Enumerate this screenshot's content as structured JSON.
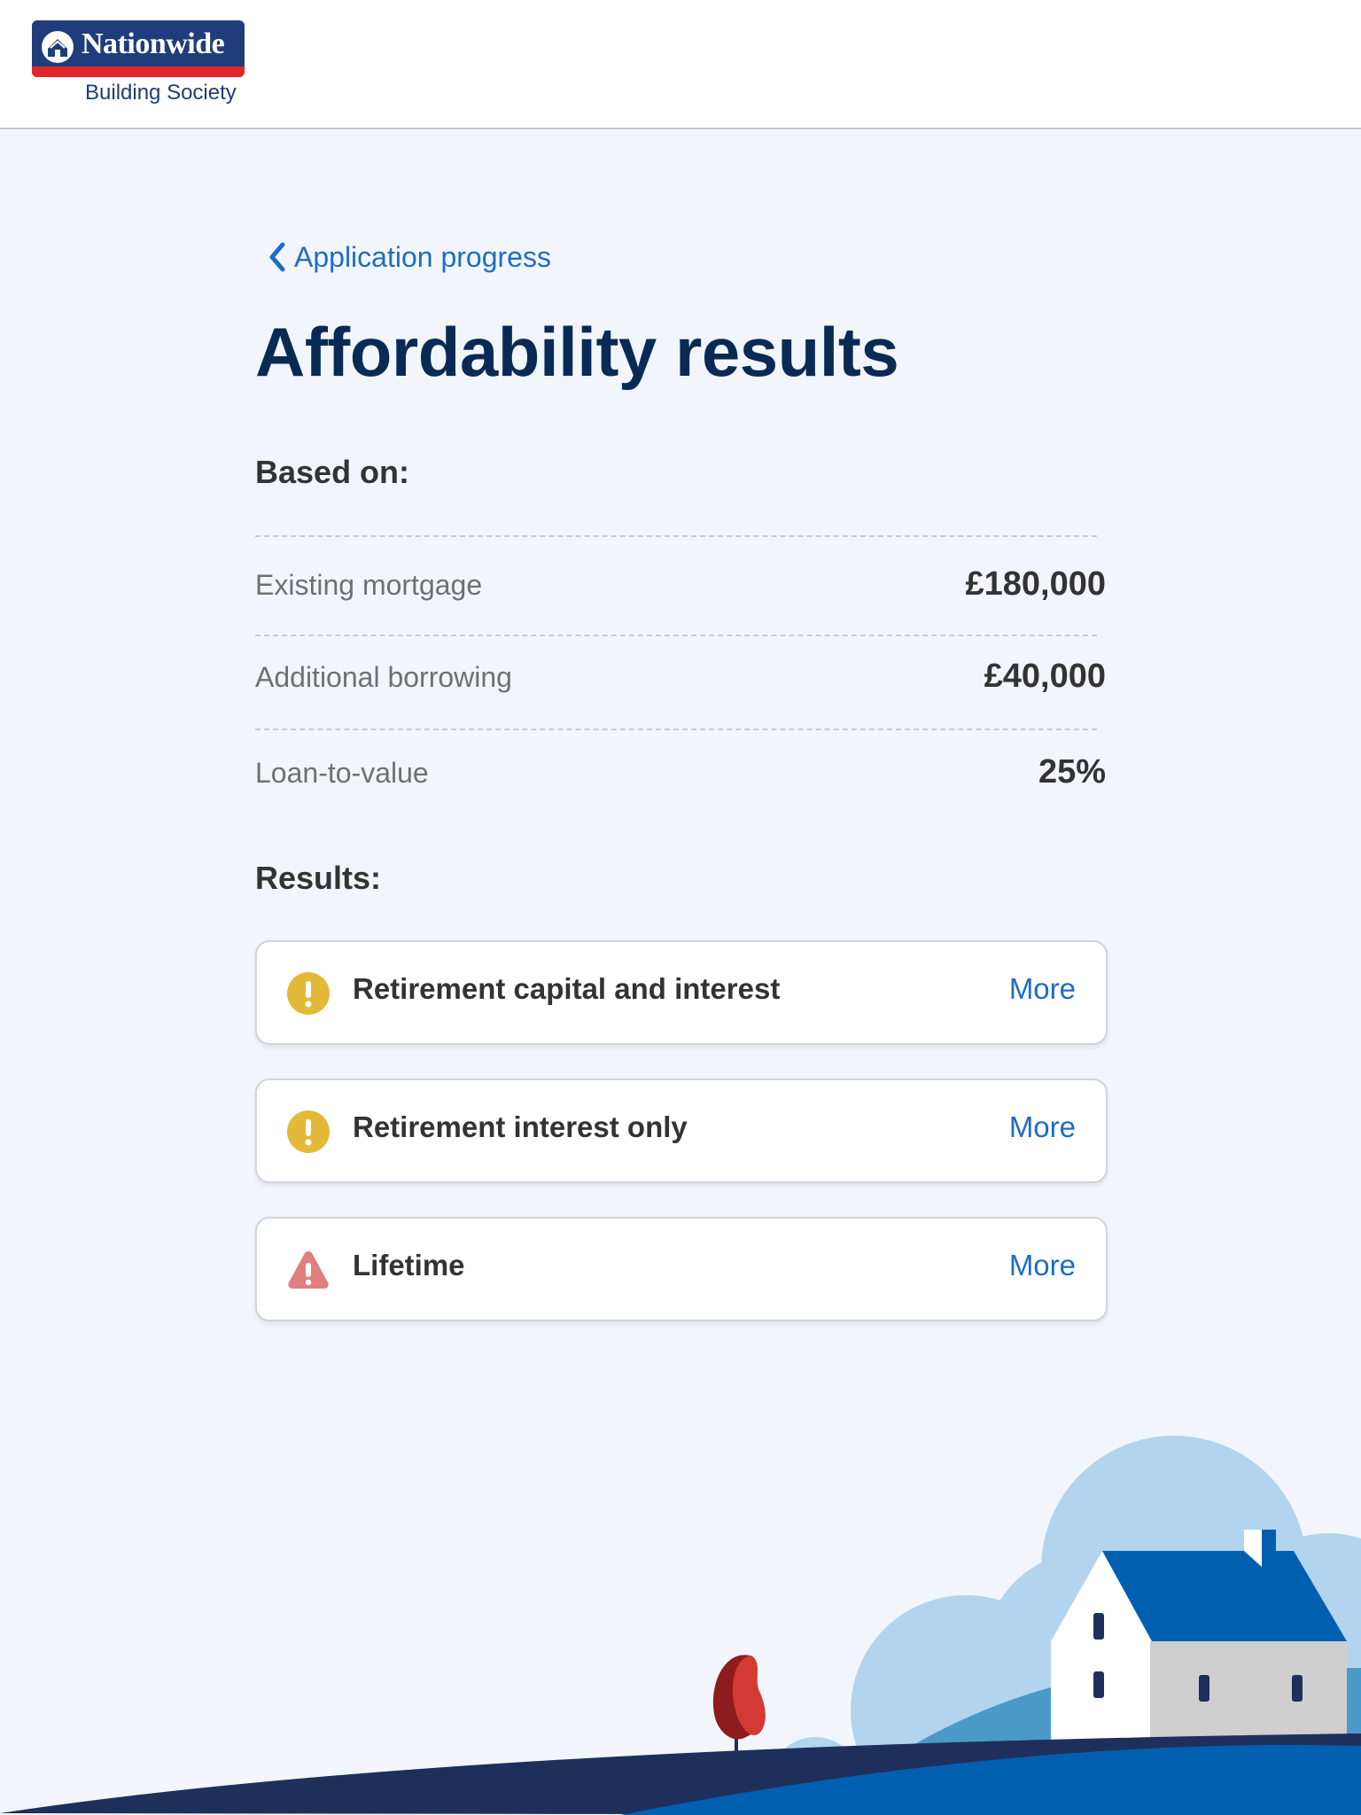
{
  "header": {
    "logo_name": "Nationwide",
    "logo_sub": "Building Society"
  },
  "nav": {
    "back_label": "Application progress"
  },
  "page": {
    "title": "Affordability results"
  },
  "based_on": {
    "heading": "Based on:",
    "rows": [
      {
        "label": "Existing mortgage",
        "value": "£180,000"
      },
      {
        "label": "Additional borrowing",
        "value": "£40,000"
      },
      {
        "label": "Loan-to-value",
        "value": "25%"
      }
    ]
  },
  "results": {
    "heading": "Results:",
    "items": [
      {
        "title": "Retirement capital and interest",
        "more_label": "More",
        "status_icon": "warning-circle-icon",
        "status_color": "#e3b93a"
      },
      {
        "title": "Retirement interest only",
        "more_label": "More",
        "status_icon": "warning-circle-icon",
        "status_color": "#e3b93a"
      },
      {
        "title": "Lifetime",
        "more_label": "More",
        "status_icon": "alert-triangle-icon",
        "status_color": "#e07f7f"
      }
    ]
  },
  "colors": {
    "brand_navy": "#1f3d7a",
    "brand_red": "#e3262b",
    "link_blue": "#1e6cc8",
    "title_navy": "#0a2a56",
    "background": "#f2f6fc"
  }
}
